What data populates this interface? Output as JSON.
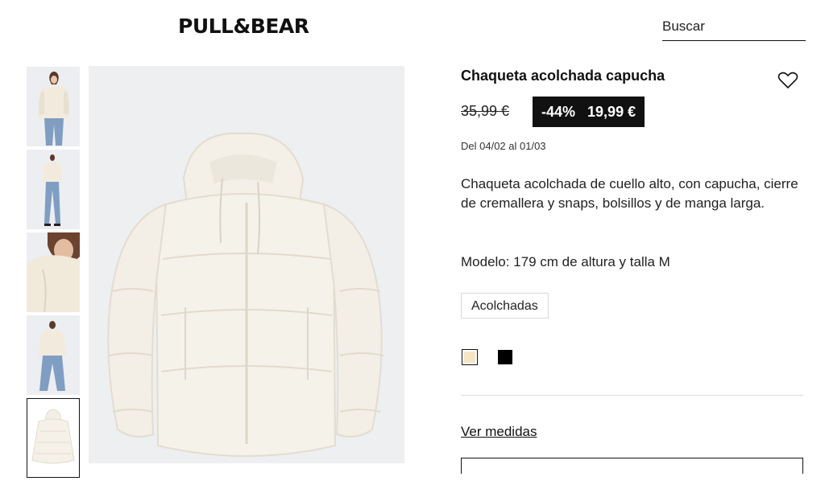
{
  "header": {
    "brand": "PULL&BEAR",
    "search_label": "Buscar"
  },
  "gallery": {
    "thumbnails": [
      "thumb-front-model",
      "thumb-full-body",
      "thumb-closeup",
      "thumb-standing",
      "thumb-product"
    ],
    "selected_index": 4
  },
  "product": {
    "title": "Chaqueta acolchada capucha",
    "old_price": "35,99 €",
    "discount": "-44%",
    "sale_price": "19,99 €",
    "dates": "Del 04/02 al 01/03",
    "description": "Chaqueta acolchada de cuello alto, con capucha, cierre de cremallera y snaps, bolsillos y de manga larga.",
    "model_info": "Modelo: 179 cm de altura y talla M",
    "tag": "Acolchadas",
    "colors": [
      {
        "name": "cream",
        "hex": "#f4e6c4",
        "selected": true
      },
      {
        "name": "black",
        "hex": "#000000",
        "selected": false
      }
    ],
    "sizes_link": "Ver medidas"
  },
  "icons": {
    "wishlist": "heart-icon"
  }
}
